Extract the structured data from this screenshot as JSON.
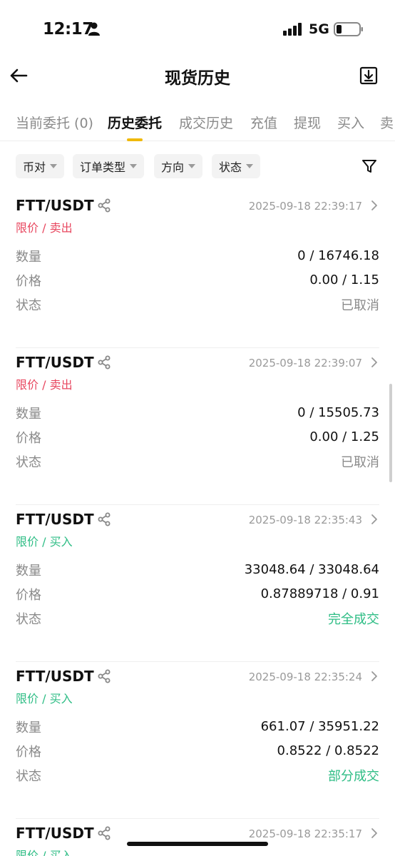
{
  "status_bar": {
    "time": "12:17",
    "network": "5G"
  },
  "nav": {
    "title": "现货历史"
  },
  "tabs": [
    "当前委托 (0)",
    "历史委托",
    "成交历史",
    "充值",
    "提现",
    "买入",
    "卖"
  ],
  "active_tab": 1,
  "filters": [
    "币对",
    "订单类型",
    "方向",
    "状态"
  ],
  "labels": {
    "quantity": "数量",
    "price": "价格",
    "status": "状态"
  },
  "orders": [
    {
      "pair": "FTT/USDT",
      "time": "2025-09-18 22:39:17",
      "type": "限价 / 卖出",
      "side": "sell",
      "quantity": "0 / 16746.18",
      "price": "0.00 / 1.15",
      "status": "已取消"
    },
    {
      "pair": "FTT/USDT",
      "time": "2025-09-18 22:39:07",
      "type": "限价 / 卖出",
      "side": "sell",
      "quantity": "0 / 15505.73",
      "price": "0.00 / 1.25",
      "status": "已取消"
    },
    {
      "pair": "FTT/USDT",
      "time": "2025-09-18 22:35:43",
      "type": "限价 / 买入",
      "side": "buy",
      "quantity": "33048.64 / 33048.64",
      "price": "0.87889718 / 0.91",
      "status": "完全成交"
    },
    {
      "pair": "FTT/USDT",
      "time": "2025-09-18 22:35:24",
      "type": "限价 / 买入",
      "side": "buy",
      "quantity": "661.07 / 35951.22",
      "price": "0.8522 / 0.8522",
      "status": "部分成交"
    },
    {
      "pair": "FTT/USDT",
      "time": "2025-09-18 22:35:17",
      "type": "限价 / 买入",
      "side": "buy"
    }
  ],
  "colors": {
    "accent": "#f0b90b",
    "sell": "#e8475f",
    "buy": "#2ebd85",
    "muted": "#8a8a8a"
  }
}
